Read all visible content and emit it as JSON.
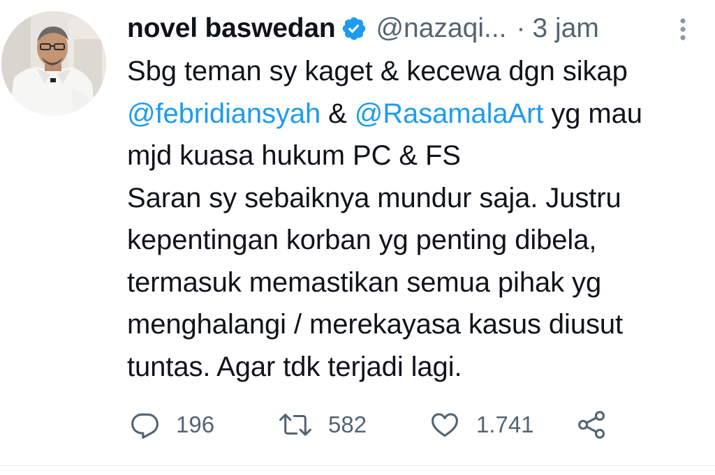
{
  "tweet": {
    "author_name": "novel baswedan",
    "handle": "@nazaqi...",
    "separator": "·",
    "time": "3 jam",
    "verified": true,
    "line1": "Sbg teman sy kaget & kecewa dgn sikap",
    "mention1": "@febridiansyah",
    "amp": " & ",
    "mention2": "@RasamalaArt",
    "line2_tail": " yg mau",
    "line3": "mjd kuasa hukum PC & FS",
    "line4": "Saran sy sebaiknya mundur saja. Justru",
    "line5": "kepentingan korban yg penting dibela,",
    "line6": "termasuk memastikan semua pihak yg",
    "line7": "menghalangi / merekayasa kasus diusut",
    "line8": "tuntas. Agar tdk terjadi lagi."
  },
  "actions": {
    "reply_count": "196",
    "retweet_count": "582",
    "like_count": "1.741"
  },
  "icons": {
    "reply": "reply-icon",
    "retweet": "retweet-icon",
    "like": "heart-icon",
    "share": "share-icon",
    "more": "more-vertical-icon",
    "verified": "verified-badge-icon"
  },
  "colors": {
    "accent": "#1d9bf0",
    "text": "#0f1419",
    "muted": "#536471"
  }
}
